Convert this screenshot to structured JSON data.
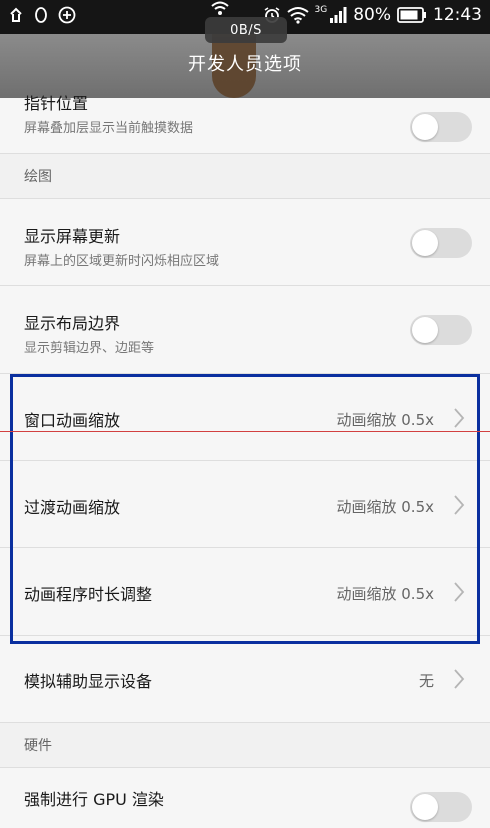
{
  "status_bar": {
    "network_speed": "0B/S",
    "signal_type": "3G",
    "battery_percent": "80%",
    "time": "12:43"
  },
  "header": {
    "title": "开发人员选项"
  },
  "rows": {
    "pointer_location": {
      "title": "指针位置",
      "subtitle": "屏幕叠加层显示当前触摸数据",
      "enabled": false
    },
    "section_drawing": "绘图",
    "show_surface_updates": {
      "title": "显示屏幕更新",
      "subtitle": "屏幕上的区域更新时闪烁相应区域",
      "enabled": false
    },
    "show_layout_bounds": {
      "title": "显示布局边界",
      "subtitle": "显示剪辑边界、边距等",
      "enabled": false
    },
    "window_animation_scale": {
      "title": "窗口动画缩放",
      "value": "动画缩放 0.5x"
    },
    "transition_animation_scale": {
      "title": "过渡动画缩放",
      "value": "动画缩放 0.5x"
    },
    "animator_duration_scale": {
      "title": "动画程序时长调整",
      "value": "动画缩放 0.5x"
    },
    "simulate_secondary_displays": {
      "title": "模拟辅助显示设备",
      "value": "无"
    },
    "section_hardware": "硬件",
    "force_gpu_rendering": {
      "title": "强制进行 GPU 渲染"
    }
  },
  "colors": {
    "highlight_border": "#0a2f9f",
    "status_bar_bg": "#151515"
  }
}
